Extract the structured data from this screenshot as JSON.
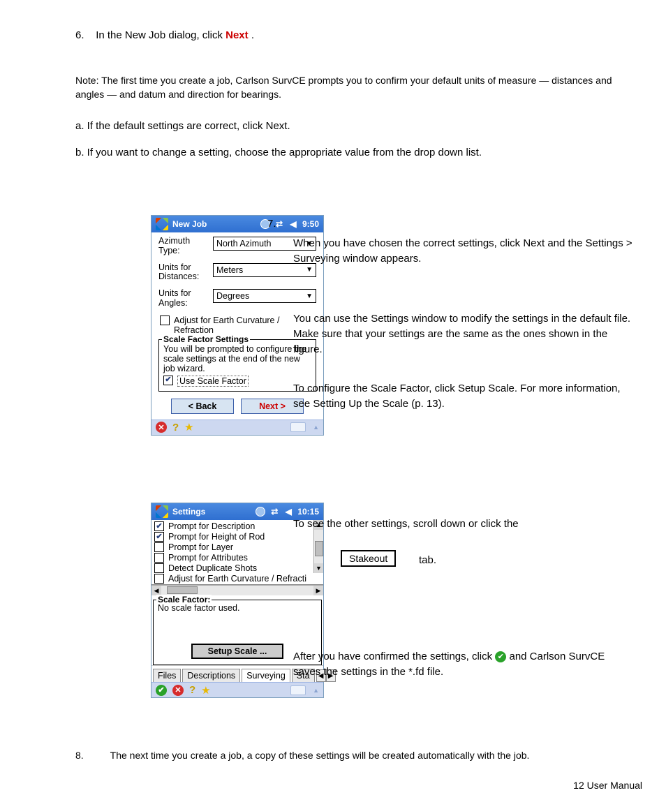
{
  "top_section": {
    "step_num": "6.",
    "step_text": "In the New Job dialog, click ",
    "next_link": "Next",
    "step_tail": ".",
    "note_text": "Note:  The first time you create a job, Carlson SurvCE prompts you to confirm your default units of measure — distances and angles — and datum and direction for bearings.",
    "sub1": "a.    If the default settings are correct, click Next.",
    "sub2": "b.    If you want to change a setting, choose the appropriate value from the drop down list."
  },
  "device1": {
    "title": "New Job",
    "time": "9:50",
    "rows": [
      {
        "label": "Azimuth Type:",
        "value": "North Azimuth"
      },
      {
        "label": "Units for Distances:",
        "value": "Meters"
      },
      {
        "label": "Units for Angles:",
        "value": "Degrees"
      }
    ],
    "earth_chk": "Adjust for Earth Curvature / Refraction",
    "group_title": "Scale Factor Settings",
    "group_text": "You will be prompted to configure the scale settings at the end of the new job wizard.",
    "use_scale": "Use Scale Factor",
    "back": "< Back",
    "next": "Next >"
  },
  "right1": {
    "num7": "7.",
    "p1": "When you have chosen the correct settings, click Next and the Settings > Surveying window appears.",
    "p2": "You can use the Settings window to modify the settings in the default file. Make sure that your settings are the same as the ones shown in the figure.",
    "p3": "To configure the Scale Factor, click Setup Scale. For more information, see Setting Up the Scale (p. 13)."
  },
  "device2": {
    "title": "Settings",
    "time": "10:15",
    "items": [
      {
        "label": "Prompt for Description",
        "checked": true
      },
      {
        "label": "Prompt for Height of Rod",
        "checked": true
      },
      {
        "label": "Prompt for Layer",
        "checked": false
      },
      {
        "label": "Prompt for Attributes",
        "checked": false
      },
      {
        "label": "Detect Duplicate Shots",
        "checked": false
      },
      {
        "label": "Adjust for Earth Curvature / Refracti",
        "checked": false
      }
    ],
    "sf_title": "Scale Factor:",
    "sf_msg": "No scale factor used.",
    "setup_btn": "Setup Scale ...",
    "tabs": [
      "Files",
      "Descriptions",
      "Surveying",
      "Sta"
    ]
  },
  "right2": {
    "p1a": "To see the other settings, scroll down or click the ",
    "stakeout_box": "Stakeout",
    "p1b": " tab.",
    "p2a": "After you have confirmed the settings, click ",
    "p2b": " and Carlson SurvCE saves the settings in the *.fd file."
  },
  "bottom_step": {
    "num": "8.",
    "text": "The next time you create a job, a copy of these settings will be created automatically with the job."
  },
  "footer": "12      User Manual"
}
